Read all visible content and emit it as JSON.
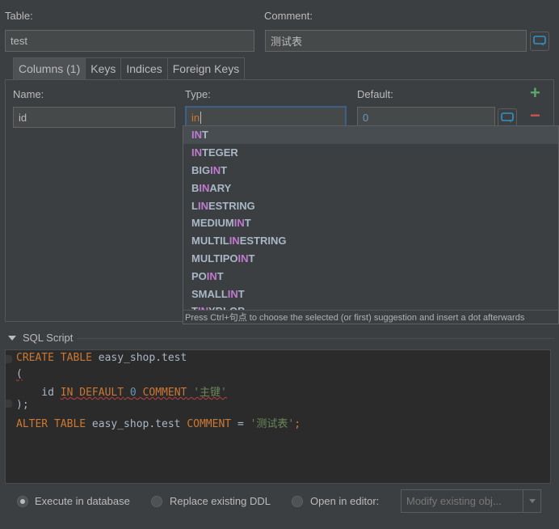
{
  "table": {
    "label": "Table:",
    "value": "test"
  },
  "comment": {
    "label": "Comment:",
    "value": "测试表"
  },
  "tabs": [
    {
      "label": "Columns (1)"
    },
    {
      "label": "Keys"
    },
    {
      "label": "Indices"
    },
    {
      "label": "Foreign Keys"
    }
  ],
  "columns": {
    "name_label": "Name:",
    "type_label": "Type:",
    "default_label": "Default:",
    "name_value": "id",
    "type_value": "in",
    "default_value": "0",
    "add_symbol": "+",
    "remove_symbol": "−"
  },
  "autocomplete": {
    "items": [
      {
        "pre": "",
        "match": "IN",
        "post": "T"
      },
      {
        "pre": "",
        "match": "IN",
        "post": "TEGER"
      },
      {
        "pre": "BIG",
        "match": "IN",
        "post": "T"
      },
      {
        "pre": "B",
        "match": "IN",
        "post": "ARY"
      },
      {
        "pre": "L",
        "match": "IN",
        "post": "ESTRING"
      },
      {
        "pre": "MEDIUM",
        "match": "IN",
        "post": "T"
      },
      {
        "pre": "MULTIL",
        "match": "IN",
        "post": "ESTRING"
      },
      {
        "pre": "MULTIPO",
        "match": "IN",
        "post": "T"
      },
      {
        "pre": "PO",
        "match": "IN",
        "post": "T"
      },
      {
        "pre": "SMALL",
        "match": "IN",
        "post": "T"
      },
      {
        "pre": "T",
        "match": "IN",
        "post": "YBLOB"
      }
    ],
    "hint": "Press Ctrl+句点 to choose the selected (or first) suggestion and insert a dot afterwards"
  },
  "sql_section": {
    "title": "SQL Script"
  },
  "sql": {
    "l1_kw": "CREATE TABLE",
    "l1_rest": " easy_shop.test",
    "l2": "(",
    "l3_name": "    id ",
    "l3_in": "IN",
    "l3_default": "DEFAULT",
    "l3_num": "0",
    "l3_comment": "COMMENT",
    "l3_str": "'主键'",
    "l4": ");",
    "l5_kw": "ALTER TABLE",
    "l5_rest": " easy_shop.test ",
    "l5_comment": "COMMENT",
    "l5_eq": " = ",
    "l5_str": "'测试表'",
    "l5_end": ";"
  },
  "options": {
    "execute": "Execute in database",
    "replace": "Replace existing DDL",
    "open": "Open in editor:",
    "editor_select": "Modify existing obj..."
  },
  "colors": {
    "background": "#3c3f41",
    "editor_bg": "#2b2b2b",
    "keyword": "#cc7832",
    "string": "#6a8759",
    "number": "#6897bb",
    "match_highlight": "#c07bd0",
    "add_green": "#59a869",
    "remove_red": "#c75450"
  }
}
